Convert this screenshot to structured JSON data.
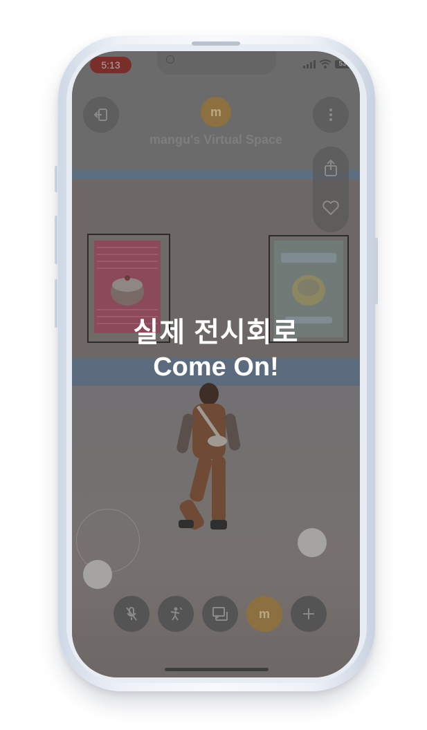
{
  "status_bar": {
    "time": "5:13",
    "battery_level": "53"
  },
  "header": {
    "avatar_initial": "m",
    "space_title": "mangu's Virtual Space"
  },
  "overlay": {
    "title": "실제 전시회로",
    "subtitle": "Come On!"
  },
  "toolbar": {
    "avatar_initial": "m",
    "icons": [
      "mic-off-icon",
      "emote-icon",
      "chat-icon",
      "avatar",
      "plus-icon"
    ]
  },
  "colors": {
    "dim_overlay": "#6f6d6b",
    "avatar_accent": "#8d7040",
    "time_pill": "#7a2e2a",
    "overlay_text": "#ffffff"
  }
}
